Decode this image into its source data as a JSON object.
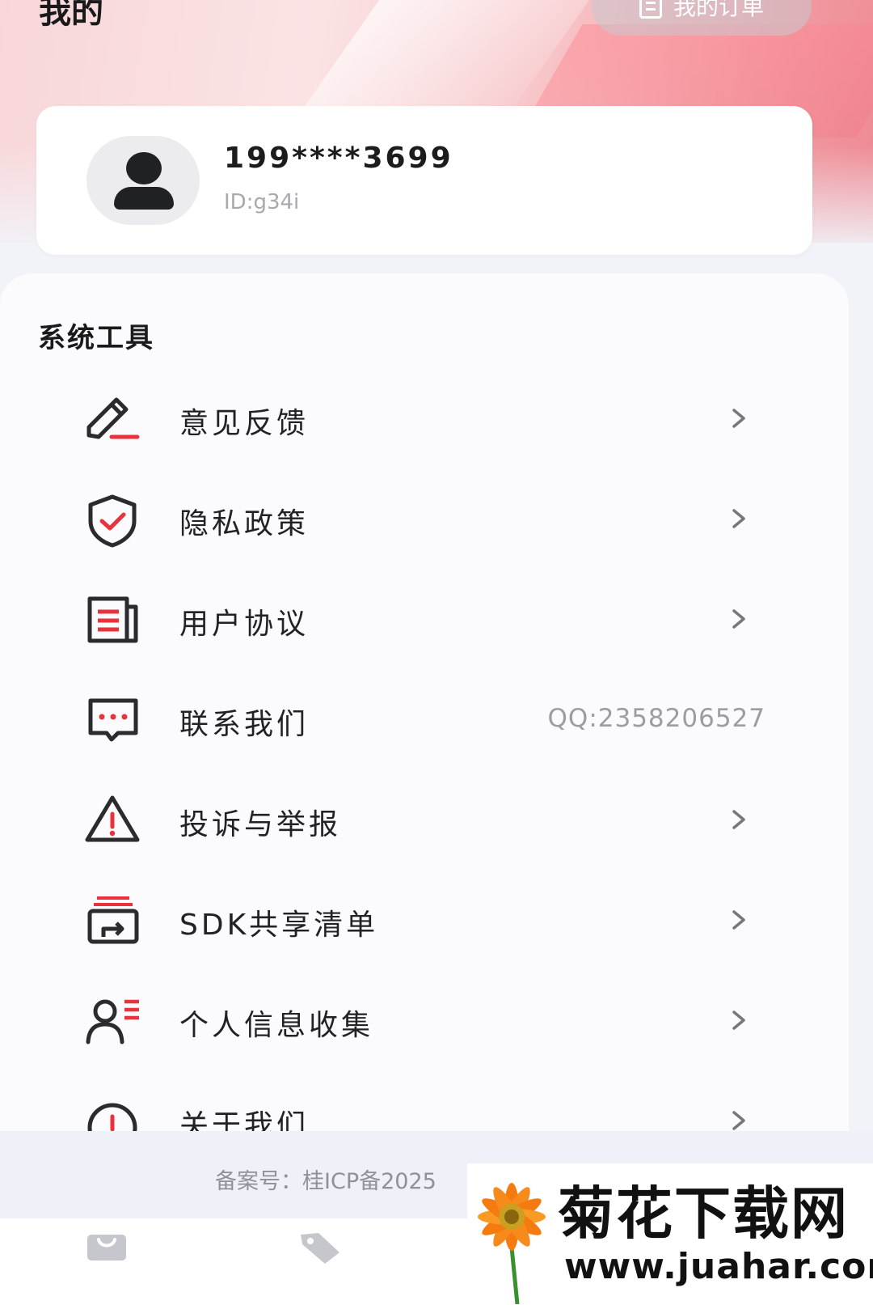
{
  "header": {
    "title": "我的",
    "orders_button": "我的订单"
  },
  "profile": {
    "phone": "199****3699",
    "id_text": "ID:g34i"
  },
  "tools": {
    "section_title": "系统工具",
    "items": [
      {
        "label": "意见反馈",
        "icon": "edit-pen-icon"
      },
      {
        "label": "隐私政策",
        "icon": "shield-check-icon"
      },
      {
        "label": "用户协议",
        "icon": "document-list-icon"
      },
      {
        "label": "联系我们",
        "icon": "chat-bubble-icon",
        "value": "QQ:2358206527"
      },
      {
        "label": "投诉与举报",
        "icon": "warning-triangle-icon"
      },
      {
        "label": "SDK共享清单",
        "icon": "share-box-icon"
      },
      {
        "label": "个人信息收集",
        "icon": "user-list-icon"
      },
      {
        "label": "关于我们",
        "icon": "info-circle-icon"
      }
    ]
  },
  "footer": {
    "icp": "备案号：桂ICP备2025"
  },
  "watermark": {
    "title": "菊花下载网",
    "url": "www.juahar.com"
  },
  "colors": {
    "accent": "#e8323c",
    "icon_dark": "#2b2b2e",
    "text": "#222226",
    "muted": "#9c9ca2"
  }
}
